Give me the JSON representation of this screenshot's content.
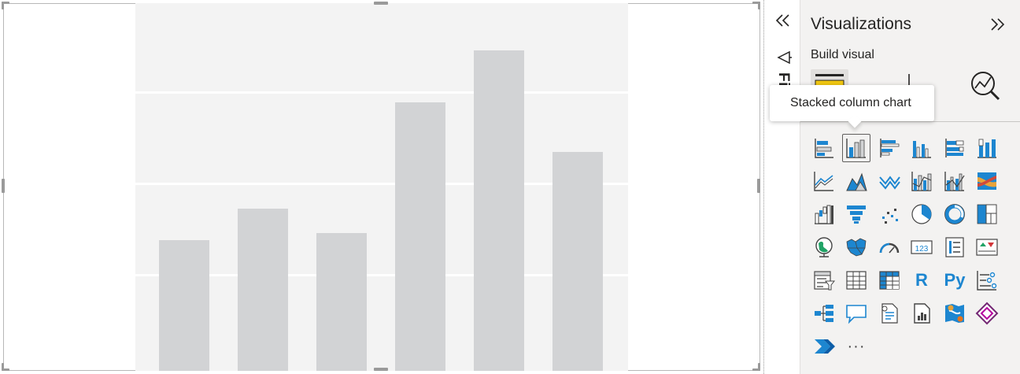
{
  "canvas": {
    "placeholder_chart": {
      "gridline_count": 3,
      "bars_relative_height": [
        0.356,
        0.442,
        0.374,
        0.732,
        0.873,
        0.597
      ]
    }
  },
  "filters_pane": {
    "label": "Filters",
    "collapse_icon": "double-chevron-left-icon",
    "funnel_icon": "funnel-icon"
  },
  "visualizations_pane": {
    "title": "Visualizations",
    "expand_icon": "double-chevron-right-icon",
    "build_visual_label": "Build visual",
    "build_tabs": [
      "build-visual-tab-icon",
      "format-visual-tab-icon",
      "analytics-tab-icon"
    ],
    "selected_visual": "Stacked column chart",
    "more_label": "···",
    "r_label": "R",
    "py_label": "Py",
    "card_label": "123",
    "visual_icons": [
      [
        "stacked-bar-chart-icon",
        "stacked-column-chart-icon",
        "clustered-bar-chart-icon",
        "clustered-column-chart-icon",
        "100-stacked-bar-chart-icon",
        "100-stacked-column-chart-icon"
      ],
      [
        "line-chart-icon",
        "area-chart-icon",
        "stacked-area-chart-icon",
        "line-and-stacked-column-icon",
        "line-and-clustered-column-icon",
        "ribbon-chart-icon"
      ],
      [
        "waterfall-chart-icon",
        "funnel-chart-icon",
        "scatter-chart-icon",
        "pie-chart-icon",
        "donut-chart-icon",
        "treemap-icon"
      ],
      [
        "map-icon",
        "filled-map-icon",
        "gauge-icon",
        "card-icon",
        "multi-row-card-icon",
        "kpi-icon"
      ],
      [
        "slicer-icon",
        "table-icon",
        "matrix-icon",
        "r-script-visual-icon",
        "python-visual-icon",
        "key-influencers-icon"
      ],
      [
        "decomposition-tree-icon",
        "qa-icon",
        "smart-narrative-icon",
        "paginated-report-icon",
        "azure-map-icon",
        "power-apps-icon"
      ],
      [
        "power-automate-icon",
        "more-visuals-icon"
      ]
    ]
  },
  "tooltip": {
    "text": "Stacked column chart"
  },
  "colors": {
    "accent_blue": "#1d86d0",
    "accent_yellow": "#f2c811",
    "pane_bg": "#f3f2f1",
    "bar_gray": "#d2d3d5"
  }
}
